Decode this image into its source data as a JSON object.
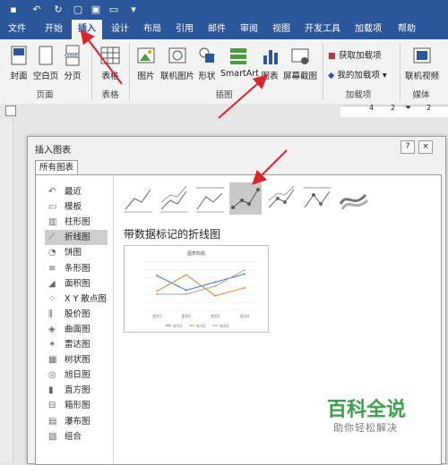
{
  "tabs": [
    "文件",
    "开始",
    "插入",
    "设计",
    "布局",
    "引用",
    "邮件",
    "审阅",
    "视图",
    "开发工具",
    "加载项",
    "帮助"
  ],
  "ribbon": {
    "cover": "封面",
    "blank_page": "空白页",
    "page_break": "分页",
    "table": "表格",
    "picture": "图片",
    "online_picture": "联机图片",
    "shapes": "形状",
    "smartart": "SmartArt",
    "chart": "图表",
    "screenshot": "屏幕截图",
    "get_addins": "获取加载项",
    "my_addins": "我的加载项",
    "online_video": "联机视频",
    "groups": {
      "pages": "页面",
      "tables": "表格",
      "illustrations": "插图",
      "addins": "加载项",
      "media": "媒体"
    }
  },
  "ruler": {
    "marks": [
      "4",
      "2",
      "2"
    ]
  },
  "dialog": {
    "title": "插入图表",
    "help_btn": "?",
    "close_btn": "×",
    "tab": "所有图表",
    "categories": [
      "最近",
      "模板",
      "柱形图",
      "折线图",
      "饼图",
      "条形图",
      "面积图",
      "X Y 散点图",
      "股价图",
      "曲面图",
      "雷达图",
      "树状图",
      "旭日图",
      "直方图",
      "箱形图",
      "瀑布图",
      "组合"
    ],
    "selected_category": "折线图",
    "selected_subtype": "带数据标记的折线图"
  },
  "chart_data": {
    "type": "line",
    "title": "图表标题",
    "categories": [
      "类别1",
      "类别2",
      "类别3",
      "类别4"
    ],
    "series": [
      {
        "name": "系列1",
        "values": [
          4.3,
          2.5,
          3.5,
          4.5
        ],
        "color": "#4472c4"
      },
      {
        "name": "系列2",
        "values": [
          2.4,
          4.4,
          1.8,
          2.8
        ],
        "color": "#ed7d31"
      },
      {
        "name": "系列3",
        "values": [
          2.0,
          2.0,
          3.0,
          5.0
        ],
        "color": "#a5a5a5"
      }
    ],
    "ylim": [
      0,
      6
    ],
    "legend": "bottom"
  },
  "watermark": {
    "main": "百科全说",
    "sub": "助你轻松解决"
  },
  "colors": {
    "ribbon_blue": "#2b579a",
    "arrow_red": "#d9232d"
  }
}
